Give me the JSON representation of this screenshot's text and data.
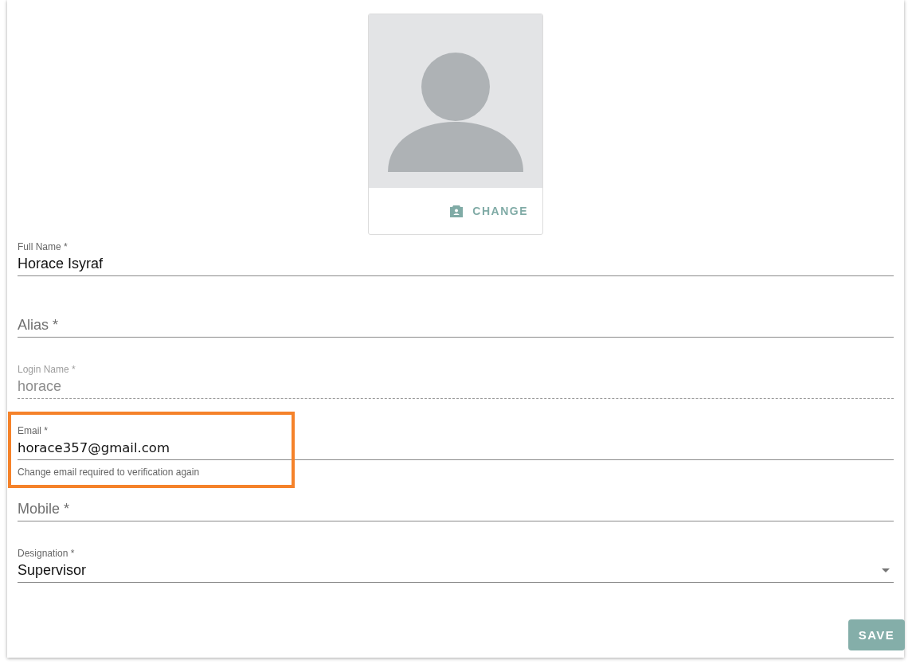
{
  "avatar": {
    "change_label": "CHANGE"
  },
  "fields": [
    {
      "kind": "text",
      "label": "Full Name *",
      "value": "Horace Isyraf",
      "disabled": false,
      "highlighted": false
    },
    {
      "kind": "text",
      "label": "Alias *",
      "disabled": false,
      "highlighted": false
    },
    {
      "kind": "text",
      "label": "Login Name *",
      "value": "horace",
      "disabled": true,
      "highlighted": false
    },
    {
      "kind": "text",
      "label": "Email *",
      "value": "horace357@gmail.com",
      "helper": "Change email required to verification again",
      "disabled": false,
      "highlighted": true
    },
    {
      "kind": "text",
      "label": "Mobile *",
      "disabled": false,
      "highlighted": false
    },
    {
      "kind": "select",
      "label": "Designation *",
      "value": "Supervisor",
      "disabled": false,
      "highlighted": false
    }
  ],
  "save_button": "SAVE"
}
